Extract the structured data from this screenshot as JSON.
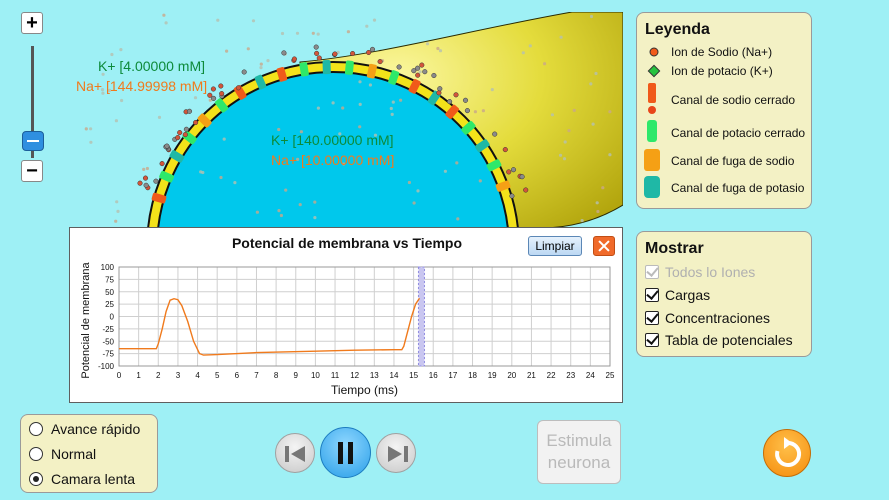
{
  "zoom": {
    "plus_label": "+",
    "minus_label": "−"
  },
  "concentrations": {
    "outside": {
      "k": "K+ [4.00000 mM]",
      "na": "Na+ [144.99998 mM]"
    },
    "inside": {
      "k": "K+ [140.00000 mM]",
      "na": "Na+ [10.00000 mM]"
    }
  },
  "legend": {
    "title": "Leyenda",
    "items": [
      {
        "label": "Ion de Sodio (Na+)",
        "icon": "sodium-ion-icon"
      },
      {
        "label": "Ion de potacio (K+)",
        "icon": "potassium-ion-icon"
      },
      {
        "label": "Canal de sodio cerrado",
        "icon": "closed-sodium-channel-icon"
      },
      {
        "label": "Canal de potacio cerrado",
        "icon": "closed-potassium-channel-icon"
      },
      {
        "label": "Canal de fuga de sodio",
        "icon": "sodium-leak-channel-icon"
      },
      {
        "label": "Canal de fuga de potasio",
        "icon": "potassium-leak-channel-icon"
      }
    ]
  },
  "show": {
    "title": "Mostrar",
    "options": [
      {
        "label": "Todos lo Iones",
        "checked": true,
        "disabled": true
      },
      {
        "label": "Cargas",
        "checked": true,
        "disabled": false
      },
      {
        "label": "Concentraciones",
        "checked": true,
        "disabled": false
      },
      {
        "label": "Tabla de potenciales",
        "checked": true,
        "disabled": false
      }
    ]
  },
  "chart_panel": {
    "title": "Potencial de membrana vs Tiempo",
    "clear_label": "Limpiar"
  },
  "chart_data": {
    "type": "line",
    "title": "",
    "xlabel": "Tiempo (ms)",
    "ylabel": "Potencial de membrana",
    "xlim": [
      0,
      25
    ],
    "ylim": [
      -100,
      100
    ],
    "xticks": [
      "0",
      "1",
      "2",
      "3",
      "4",
      "5",
      "6",
      "7",
      "8",
      "9",
      "10",
      "11",
      "12",
      "13",
      "14",
      "15",
      "16",
      "17",
      "18",
      "19",
      "20",
      "21",
      "22",
      "23",
      "24",
      "25"
    ],
    "yticks": [
      "100",
      "75",
      "50",
      "25",
      "0",
      "-25",
      "-50",
      "-75",
      "-100"
    ],
    "grid": true,
    "cursor_x": 15.4,
    "series": [
      {
        "color": "#f07a1c",
        "x": [
          0,
          1.9,
          2.0,
          2.2,
          2.4,
          2.6,
          2.8,
          3.0,
          3.2,
          3.5,
          3.8,
          4.1,
          4.3,
          5.0,
          7.0,
          10.0,
          12.0,
          14.0,
          14.4,
          14.5,
          14.7,
          14.9,
          15.1,
          15.3
        ],
        "y": [
          -65,
          -65,
          -55,
          -25,
          10,
          33,
          36,
          34,
          22,
          -10,
          -50,
          -75,
          -78,
          -77,
          -73,
          -70,
          -68,
          -67,
          -67,
          -60,
          -30,
          0,
          25,
          37
        ]
      }
    ]
  },
  "speed": {
    "options": [
      {
        "label": "Avance rápido",
        "selected": false
      },
      {
        "label": "Normal",
        "selected": false
      },
      {
        "label": "Camara lenta",
        "selected": true
      }
    ]
  },
  "controls": {
    "stimulate_label_1": "Estimula",
    "stimulate_label_2": "neurona"
  },
  "colors": {
    "background": "#9ef0f5",
    "neuron_fill": "#00c8ec",
    "axon_fill": "#e8e24a",
    "sodium": "#f07a1c",
    "potassium": "#0d8a3a"
  }
}
